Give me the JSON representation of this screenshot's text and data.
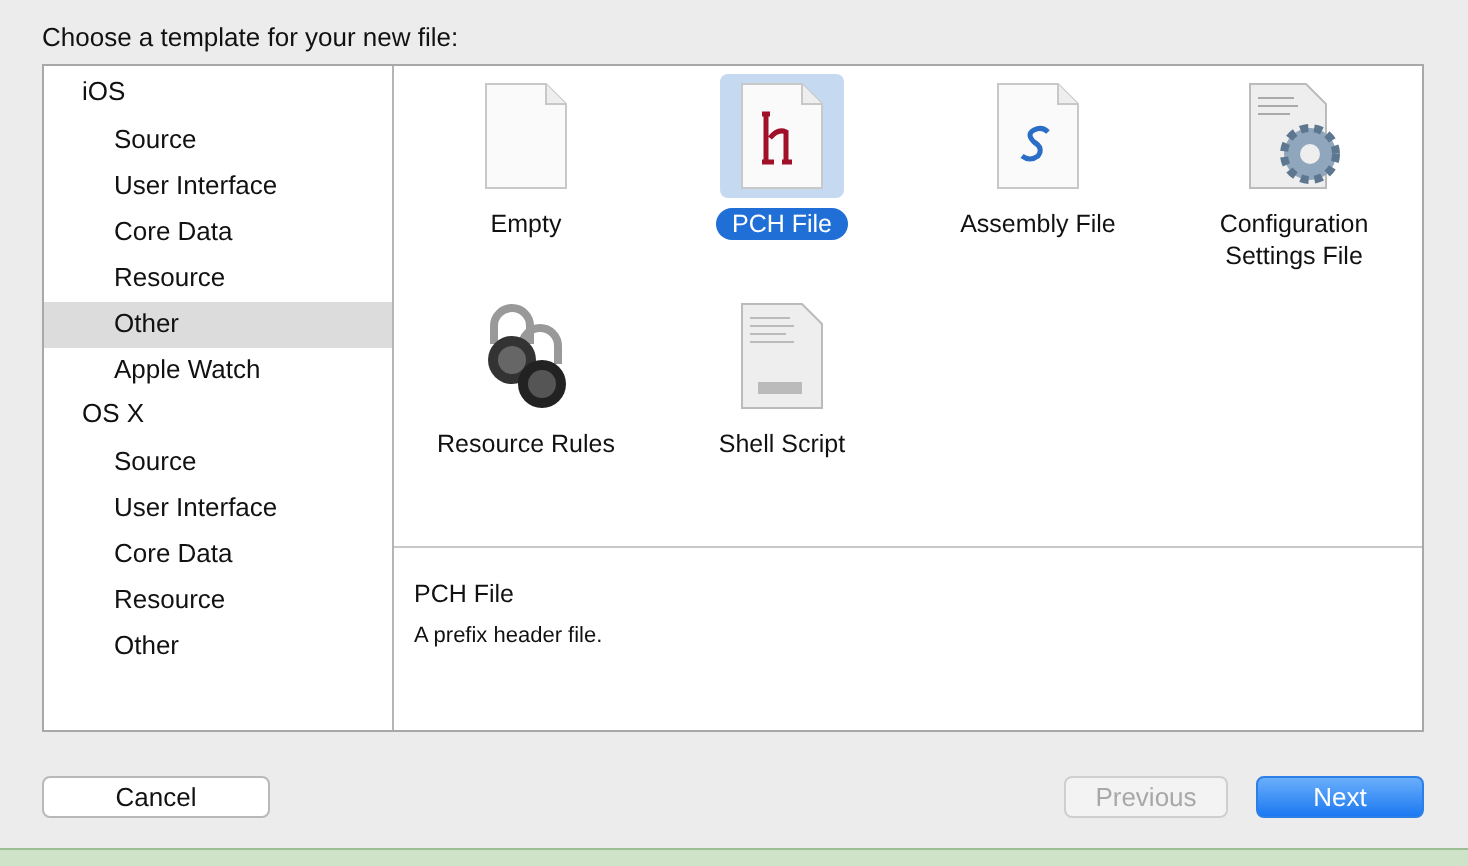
{
  "dialog": {
    "title": "Choose a template for your new file:"
  },
  "sidebar": {
    "groups": [
      {
        "label": "iOS",
        "items": [
          {
            "label": "Source",
            "selected": false
          },
          {
            "label": "User Interface",
            "selected": false
          },
          {
            "label": "Core Data",
            "selected": false
          },
          {
            "label": "Resource",
            "selected": false
          },
          {
            "label": "Other",
            "selected": true
          },
          {
            "label": "Apple Watch",
            "selected": false
          }
        ]
      },
      {
        "label": "OS X",
        "items": [
          {
            "label": "Source",
            "selected": false
          },
          {
            "label": "User Interface",
            "selected": false
          },
          {
            "label": "Core Data",
            "selected": false
          },
          {
            "label": "Resource",
            "selected": false
          },
          {
            "label": "Other",
            "selected": false
          }
        ]
      }
    ]
  },
  "templates": [
    {
      "kind": "blank",
      "label": "Empty",
      "selected": false
    },
    {
      "kind": "header",
      "label": "PCH File",
      "selected": true
    },
    {
      "kind": "assembly",
      "label": "Assembly File",
      "selected": false
    },
    {
      "kind": "config",
      "label": "Configuration Settings File",
      "selected": false
    },
    {
      "kind": "locks",
      "label": "Resource Rules",
      "selected": false
    },
    {
      "kind": "shell",
      "label": "Shell Script",
      "selected": false
    }
  ],
  "description": {
    "title": "PCH File",
    "text": "A prefix header file."
  },
  "buttons": [
    {
      "label": "Cancel",
      "kind": "normal",
      "disabled": false
    },
    {
      "label": "Previous",
      "kind": "normal",
      "disabled": true
    },
    {
      "label": "Next",
      "kind": "default",
      "disabled": false
    }
  ]
}
